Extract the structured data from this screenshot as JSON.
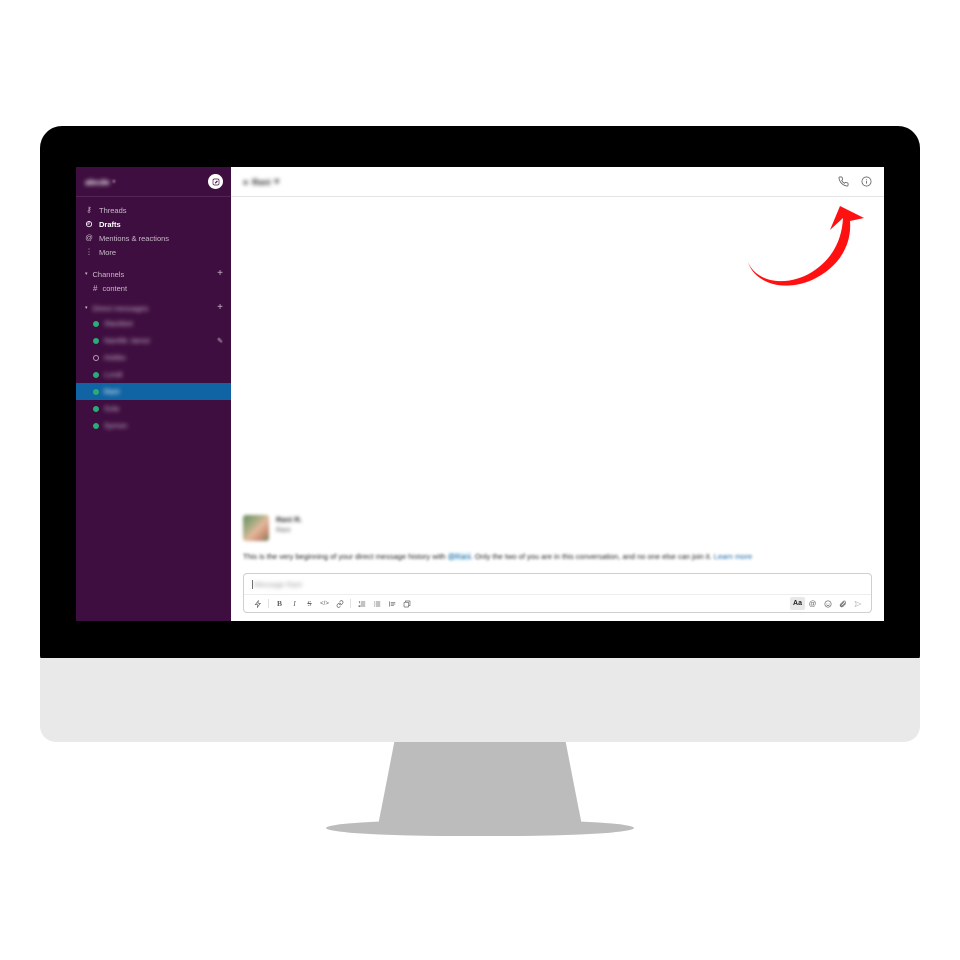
{
  "device": {
    "type": "desktop-monitor-imac"
  },
  "app": {
    "name": "Slack"
  },
  "sidebar": {
    "workspace": {
      "name": "abcde",
      "caret": "▾",
      "compose_icon": "compose-pencil-icon"
    },
    "nav": [
      {
        "icon": "threads-icon",
        "glyph": "✉",
        "label": "Threads",
        "active": false
      },
      {
        "icon": "drafts-icon",
        "glyph": "🕘",
        "label": "Drafts",
        "active": true
      },
      {
        "icon": "mentions-icon",
        "glyph": "@",
        "label": "Mentions & reactions",
        "active": false
      },
      {
        "icon": "more-icon",
        "glyph": "⋮",
        "label": "More",
        "active": false
      }
    ],
    "channels_section": {
      "triangle": "▾",
      "title": "Channels",
      "add_label": "+",
      "items": [
        {
          "prefix": "#",
          "name": "content"
        }
      ]
    },
    "dms_section": {
      "triangle": "▾",
      "title": "Direct messages",
      "add_label": "+",
      "items": [
        {
          "name": "Slackbot",
          "presence": "active",
          "selected": false,
          "pencil": false
        },
        {
          "name": "Narelle Jarosi",
          "presence": "active",
          "selected": false,
          "pencil": true
        },
        {
          "name": "Hobbs",
          "presence": "away",
          "selected": false,
          "pencil": false
        },
        {
          "name": "Lundi",
          "presence": "active",
          "selected": false,
          "pencil": false
        },
        {
          "name": "Rani",
          "presence": "active",
          "selected": true,
          "pencil": false
        },
        {
          "name": "Sula",
          "presence": "active",
          "selected": false,
          "pencil": false
        },
        {
          "name": "Symon",
          "presence": "active",
          "selected": false,
          "pencil": false
        }
      ]
    }
  },
  "channel_header": {
    "title": "Rani",
    "prefix_icon": "presence-dot-icon",
    "suffix_icon": "chevron-down-icon",
    "actions": [
      {
        "icon": "phone-call-icon",
        "label": "Call"
      },
      {
        "icon": "info-circle-icon",
        "label": "Show conversation details"
      }
    ]
  },
  "conversation": {
    "person": {
      "name": "Rani R.",
      "subtitle": "Rani",
      "avatar": "user-photo-avatar"
    },
    "intro_text_1": "This is the very beginning of your direct message history with ",
    "mention": "@Rani",
    "intro_text_2": ". Only the two of you are in this conversation, and no one else can join it. ",
    "learn_more": "Learn more"
  },
  "composer": {
    "placeholder": "Message Rani",
    "value": "",
    "left_tools": [
      {
        "icon": "formatting-lightning-icon",
        "label": "Shortcuts"
      },
      {
        "icon": "bold-icon",
        "label": "B"
      },
      {
        "icon": "italic-icon",
        "label": "I"
      },
      {
        "icon": "strikethrough-icon",
        "label": "S"
      },
      {
        "icon": "code-icon",
        "label": "</>"
      },
      {
        "icon": "link-icon",
        "label": "Link"
      },
      {
        "icon": "ordered-list-icon",
        "label": "Ordered list"
      },
      {
        "icon": "bulleted-list-icon",
        "label": "Bulleted list"
      },
      {
        "icon": "blockquote-icon",
        "label": "Blockquote"
      },
      {
        "icon": "code-block-icon",
        "label": "Code block"
      }
    ],
    "right_tools": [
      {
        "icon": "formatting-toggle-icon",
        "label": "Aa",
        "active": true
      },
      {
        "icon": "mention-icon",
        "label": "@"
      },
      {
        "icon": "emoji-icon",
        "label": "Emoji"
      },
      {
        "icon": "attachment-icon",
        "label": "Attach"
      },
      {
        "icon": "send-icon",
        "label": "Send"
      }
    ]
  },
  "annotation": {
    "type": "curved-arrow",
    "color": "#FF1111",
    "points_to": "phone-call-icon"
  }
}
